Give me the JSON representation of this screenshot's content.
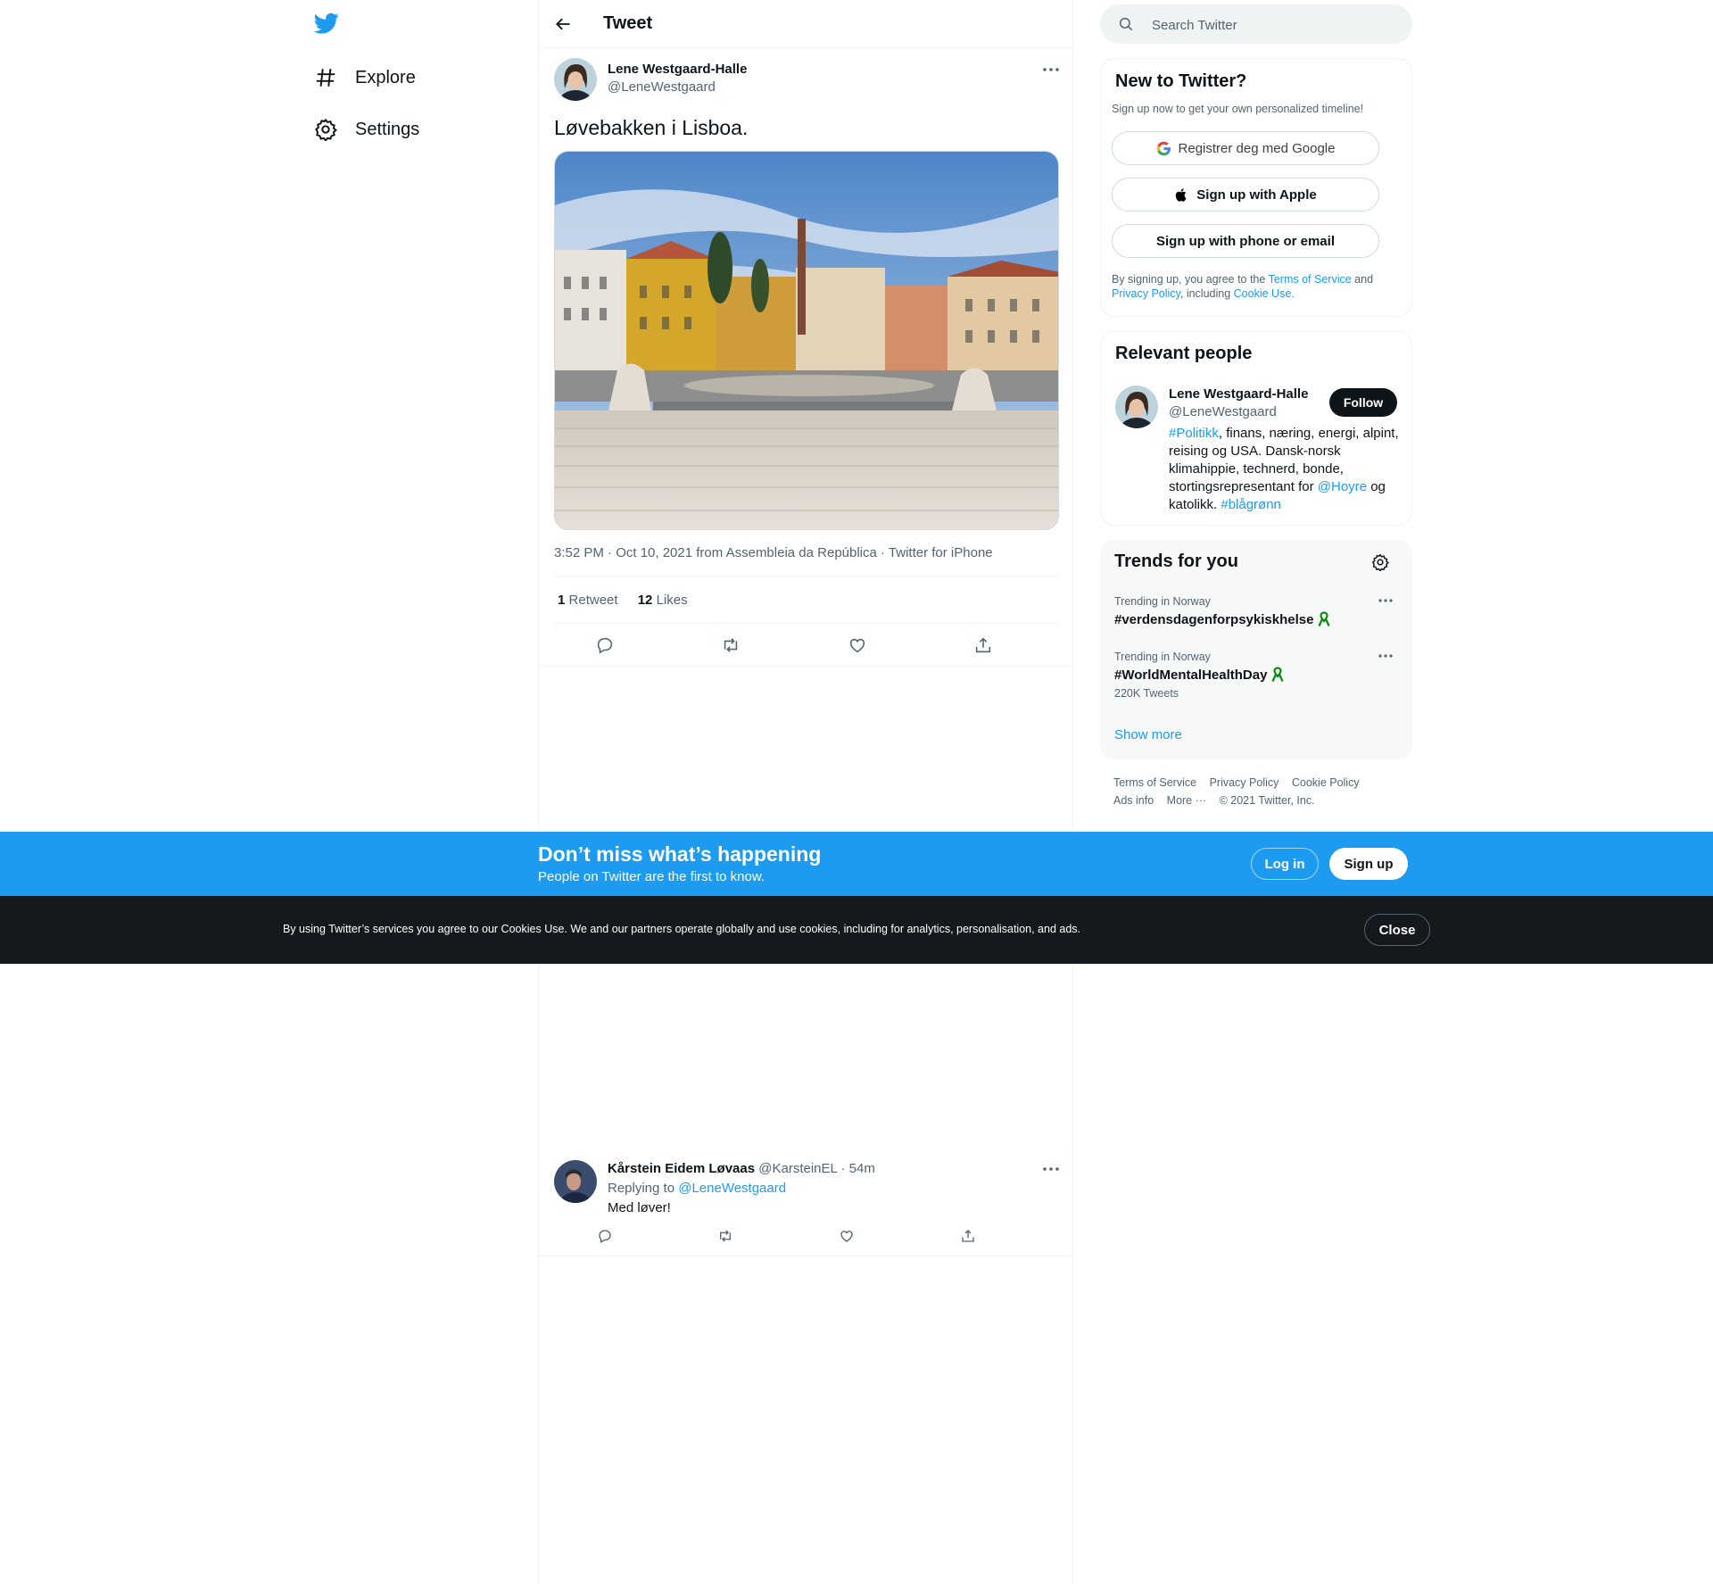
{
  "nav": {
    "logo_icon": "twitter-bird-icon",
    "items": [
      {
        "label": "Explore",
        "icon": "hashtag-icon"
      },
      {
        "label": "Settings",
        "icon": "gear-icon"
      }
    ]
  },
  "header": {
    "title": "Tweet"
  },
  "tweet": {
    "name": "Lene Westgaard-Halle",
    "handle": "@LeneWestgaard",
    "text": "Løvebakken i Lisboa.",
    "meta": "3:52 PM · Oct 10, 2021 from Assembleia da República · Twitter for iPhone",
    "retweets": {
      "count": "1",
      "label": "Retweet"
    },
    "likes": {
      "count": "12",
      "label": "Likes"
    }
  },
  "reply": {
    "name": "Kårstein Eidem Løvaas",
    "handle": "@KarsteinEL",
    "time": "· 54m",
    "replying_prefix": "Replying to",
    "replying_to": "@LeneWestgaard",
    "text": "Med løver!"
  },
  "search": {
    "placeholder": "Search Twitter"
  },
  "new_to_twitter": {
    "title": "New to Twitter?",
    "subtitle": "Sign up now to get your own personalized timeline!",
    "google_label": "Registrer deg med Google",
    "apple_label": "Sign up with Apple",
    "phone_label": "Sign up with phone or email",
    "legal": {
      "p1": "By signing up, you agree to the",
      "tos": "Terms of Service",
      "p2": "and",
      "privacy": "Privacy Policy",
      "p3": ", including",
      "cookie": "Cookie Use."
    }
  },
  "relevant_people": {
    "title": "Relevant people",
    "name": "Lene Westgaard-Halle",
    "handle": "@LeneWestgaard",
    "follow_label": "Follow",
    "bio": {
      "tag1": "#Politikk",
      "t1": ", finans, næring, energi, alpint, reising og USA. Dansk-norsk klimahippie, technerd, bonde, stortingsrepresentant for",
      "mention": "@Hoyre",
      "t2": "og katolikk.",
      "tag2": "#blågrønn"
    }
  },
  "trends": {
    "title": "Trends for you",
    "items": [
      {
        "context": "Trending in Norway",
        "name": "#verdensdagenforpsykiskhelse",
        "count": ""
      },
      {
        "context": "Trending in Norway",
        "name": "#WorldMentalHealthDay",
        "count": "220K Tweets"
      }
    ],
    "show_more": "Show more"
  },
  "footer": {
    "links": [
      "Terms of Service",
      "Privacy Policy",
      "Cookie Policy",
      "Ads info",
      "More ···"
    ],
    "copyright": "© 2021 Twitter, Inc."
  },
  "banner": {
    "title": "Don’t miss what’s happening",
    "subtitle": "People on Twitter are the first to know.",
    "login_label": "Log in",
    "signup_label": "Sign up"
  },
  "cookie_bar": {
    "text": "By using Twitter’s services you agree to our Cookies Use. We and our partners operate globally and use cookies, including for analytics, personalisation, and ads.",
    "close_label": "Close"
  },
  "colors": {
    "accent": "#1d9bf0",
    "text": "#0f1419",
    "muted": "#536471",
    "ribbon": "#0a8a0a",
    "cookie_bg": "#15181c"
  }
}
